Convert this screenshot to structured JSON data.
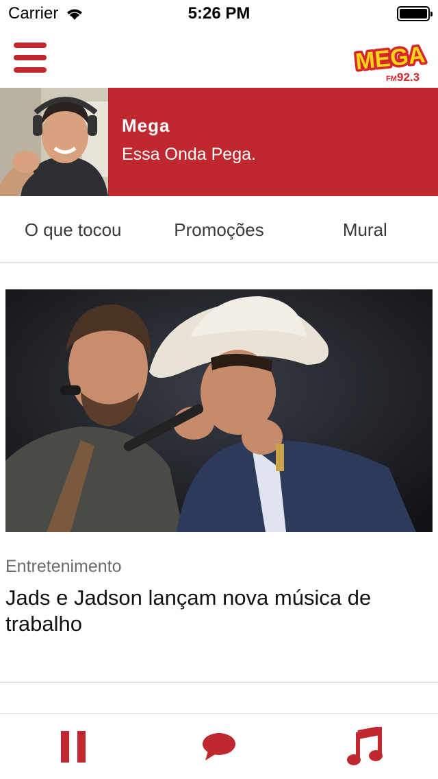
{
  "status_bar": {
    "carrier": "Carrier",
    "time": "5:26 PM",
    "battery_level": 1.0
  },
  "header": {
    "menu_icon": "hamburger-icon",
    "logo_text": "MEGA",
    "logo_sub": "FM",
    "logo_freq": "92.3"
  },
  "banner": {
    "station_name": "Mega",
    "slogan": "Essa Onda Pega."
  },
  "tabs": [
    {
      "label": "O que tocou"
    },
    {
      "label": "Promoções"
    },
    {
      "label": "Mural"
    }
  ],
  "article": {
    "category": "Entretenimento",
    "title": "Jads e Jadson lançam nova música de trabalho"
  },
  "bottom_bar": {
    "icons": [
      "pause-icon",
      "chat-icon",
      "music-note-icon"
    ]
  },
  "colors": {
    "accent": "#c0282f",
    "logo_yellow": "#f7d417",
    "logo_red": "#d7262b"
  }
}
